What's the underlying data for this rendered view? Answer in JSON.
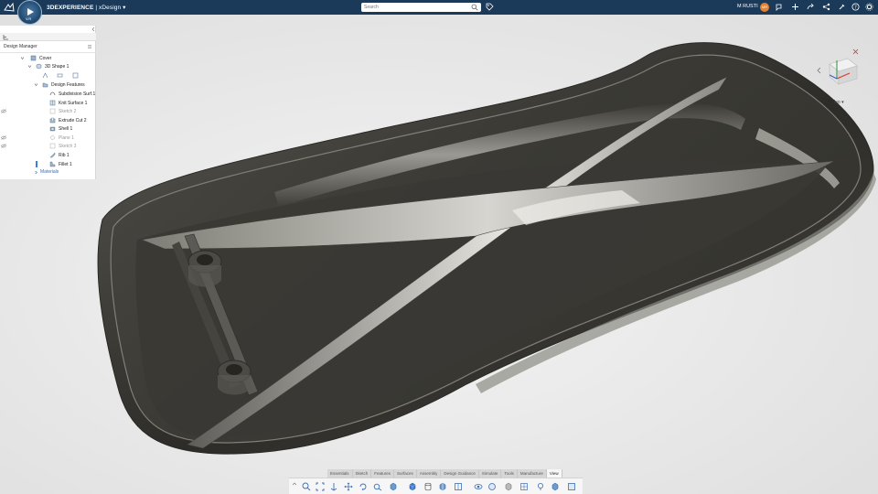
{
  "header": {
    "brand_bold": "3DEXPERIENCE",
    "brand_sep": " | ",
    "app_name": "xDesign",
    "compass_label": "V.R",
    "search_placeholder": "Search",
    "user_name": "M RUSTI",
    "user_initials": "MR"
  },
  "panel": {
    "title": "Design Manager",
    "tree": [
      {
        "label": "Cover",
        "state": "normal",
        "icon": "part-icon"
      },
      {
        "label": "3D Shape 1",
        "state": "normal",
        "icon": "shape-icon"
      },
      {
        "label": "Design Features",
        "state": "normal",
        "icon": "folder-icon"
      },
      {
        "label": "Subdivision Surf.1",
        "state": "normal",
        "icon": "subd-icon"
      },
      {
        "label": "Knit Surface 1",
        "state": "normal",
        "icon": "knit-icon"
      },
      {
        "label": "Sketch 2",
        "state": "grey",
        "icon": "sketch-icon"
      },
      {
        "label": "Extrude Cut 2",
        "state": "normal",
        "icon": "extrude-cut-icon"
      },
      {
        "label": "Shell 1",
        "state": "normal",
        "icon": "shell-icon"
      },
      {
        "label": "Plane 1",
        "state": "grey",
        "icon": "plane-icon"
      },
      {
        "label": "Sketch 3",
        "state": "grey",
        "icon": "sketch-icon"
      },
      {
        "label": "Rib 1",
        "state": "normal",
        "icon": "rib-icon"
      },
      {
        "label": "Fillet 1",
        "state": "normal",
        "icon": "fillet-icon"
      },
      {
        "label": "Materials",
        "state": "link",
        "icon": ""
      }
    ]
  },
  "viewport": {
    "view_select": "Iso"
  },
  "toolbar": {
    "tabs": [
      "Essentials",
      "Sketch",
      "Features",
      "Surfaces",
      "Assembly",
      "Design Guidance",
      "Simulate",
      "Tools",
      "Manufacture",
      "View"
    ],
    "active_tab": "View"
  },
  "colors": {
    "topbar": "#1b3a5a",
    "model_dark": "#3c3b35",
    "background": "#e9e9e9",
    "accent": "#3d7fd0"
  }
}
